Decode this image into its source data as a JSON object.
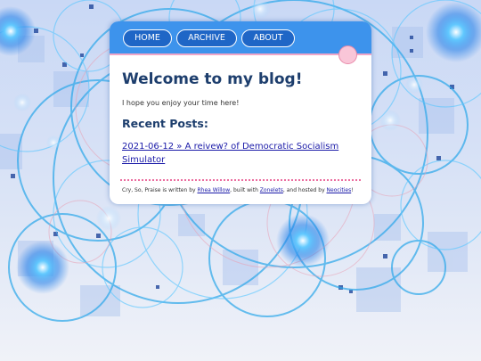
{
  "nav": {
    "items": [
      {
        "label": "HOME"
      },
      {
        "label": "ARCHIVE"
      },
      {
        "label": "ABOUT"
      }
    ]
  },
  "main": {
    "title": "Welcome to my blog!",
    "intro": "I hope you enjoy your time here!",
    "recent_heading": "Recent Posts:",
    "posts": [
      {
        "label": "2021-06-12 » A reivew? of Democratic Socialism Simulator"
      }
    ]
  },
  "footer": {
    "prefix": "Cry, So, Praise is written by ",
    "author": "Rhea Willow",
    "middle": ", built with ",
    "tool": "Zonelets",
    "middle2": ", and hosted by ",
    "host": "Neocities",
    "suffix": "!"
  },
  "colors": {
    "nav_bar": "#3d93ec",
    "nav_button": "#1f66c6",
    "heading": "#1d3e6d",
    "link": "#1a1aa8",
    "divider": "#ec6fa0",
    "pink_accent": "#f9c6d8",
    "background": "#dfe6f5"
  },
  "icons": {
    "corner_ornament": "pink-circle-icon",
    "background": "blue-circles-pattern"
  }
}
